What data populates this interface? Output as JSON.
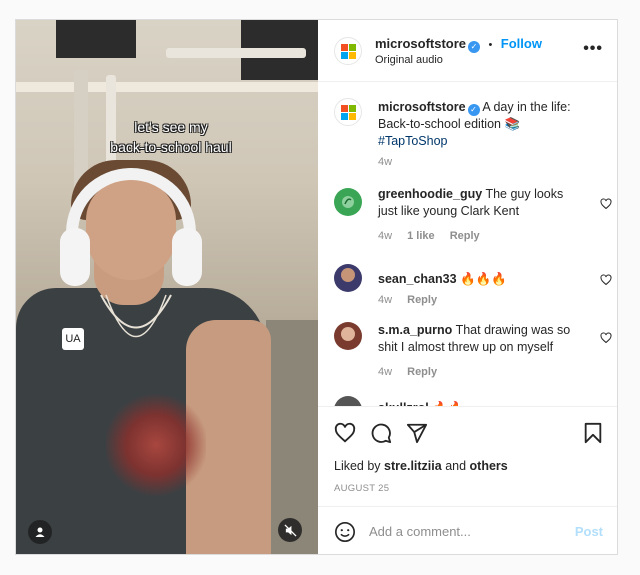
{
  "media": {
    "overlay_line1": "let's see my",
    "overlay_line2": "back-to-school haul",
    "shirt_logo": "UA",
    "profile_icon": "user-icon",
    "mute_icon": "muted-speaker-icon"
  },
  "header": {
    "username": "microsoftstore",
    "separator": "•",
    "follow_label": "Follow",
    "audio": "Original audio",
    "more_icon": "more-horizontal-icon",
    "more_glyph": "•••"
  },
  "caption": {
    "username": "microsoftstore",
    "text": "A day in the life: Back-to-school edition 📚",
    "hashtag": "#TapToShop",
    "time": "4w"
  },
  "comments": [
    {
      "username": "greenhoodie_guy",
      "text": "The guy looks just like young Clark Kent",
      "time": "4w",
      "likes": "1 like",
      "reply": "Reply",
      "avatar_color": "#3aa655"
    },
    {
      "username": "sean_chan33",
      "text": "🔥🔥🔥",
      "time": "4w",
      "reply": "Reply",
      "avatar_color": "#3b3a6b"
    },
    {
      "username": "s.m.a_purno",
      "text": "That drawing was so shit I almost threw up on myself",
      "time": "4w",
      "reply": "Reply",
      "avatar_color": "#7a3b2e"
    },
    {
      "username": "skullzrol",
      "text": "🔥🔥",
      "avatar_color": "#555555"
    }
  ],
  "actions": {
    "like_icon": "heart-icon",
    "comment_icon": "comment-icon",
    "share_icon": "share-icon",
    "save_icon": "bookmark-icon",
    "liked_prefix": "Liked by",
    "liked_user": "stre.litziia",
    "liked_and": "and",
    "liked_others": "others",
    "date": "AUGUST 25"
  },
  "add_comment": {
    "emoji_icon": "emoji-icon",
    "placeholder": "Add a comment...",
    "post_label": "Post"
  },
  "colors": {
    "accent": "#0095f6",
    "ms_red": "#f25022",
    "ms_green": "#7fba00",
    "ms_blue": "#00a4ef",
    "ms_yellow": "#ffb900"
  }
}
